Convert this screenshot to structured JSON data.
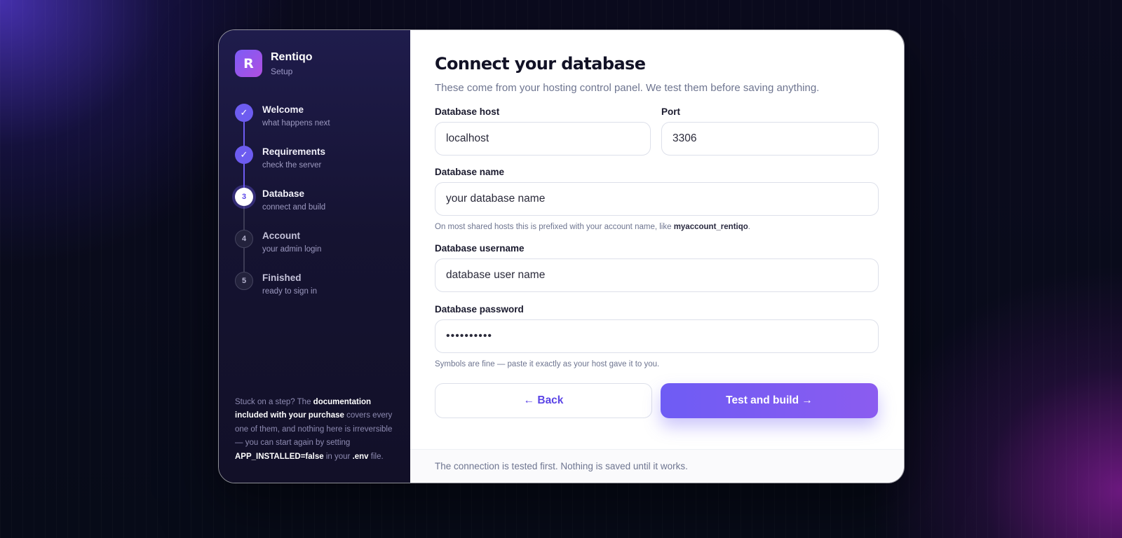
{
  "brand": {
    "logo_letter": "R",
    "name": "Rentiqo",
    "subtitle": "Setup"
  },
  "steps": [
    {
      "marker": "✓",
      "title": "Welcome",
      "desc": "what happens next",
      "state": "done"
    },
    {
      "marker": "✓",
      "title": "Requirements",
      "desc": "check the server",
      "state": "done"
    },
    {
      "marker": "3",
      "title": "Database",
      "desc": "connect and build",
      "state": "current"
    },
    {
      "marker": "4",
      "title": "Account",
      "desc": "your admin login",
      "state": "pending"
    },
    {
      "marker": "5",
      "title": "Finished",
      "desc": "ready to sign in",
      "state": "pending"
    }
  ],
  "help": {
    "part1": "Stuck on a step? The ",
    "bold1": "documentation included with your purchase",
    "part2": " covers every one of them, and nothing here is irreversible — you can start again by setting ",
    "bold2": "APP_INSTALLED=false",
    "part3": " in your ",
    "bold3": ".env",
    "part4": " file."
  },
  "main": {
    "title": "Connect your database",
    "subtitle": "These come from your hosting control panel. We test them before saving anything."
  },
  "form": {
    "host": {
      "label": "Database host",
      "value": "localhost"
    },
    "port": {
      "label": "Port",
      "value": "3306"
    },
    "name": {
      "label": "Database name",
      "value": "your database name",
      "hint_prefix": "On most shared hosts this is prefixed with your account name, like ",
      "hint_bold": "myaccount_rentiqo",
      "hint_suffix": "."
    },
    "username": {
      "label": "Database username",
      "value": "database user name"
    },
    "password": {
      "label": "Database password",
      "value": "••••••••••",
      "hint": "Symbols are fine — paste it exactly as your host gave it to you."
    }
  },
  "buttons": {
    "back": "← Back",
    "submit": "Test and build →"
  },
  "footer": "The connection is tested first. Nothing is saved until it works.",
  "colors": {
    "accent": "#6d5cf0",
    "sidebar_bg": "#151331",
    "primary_gradient_end": "#8b5cf0"
  }
}
